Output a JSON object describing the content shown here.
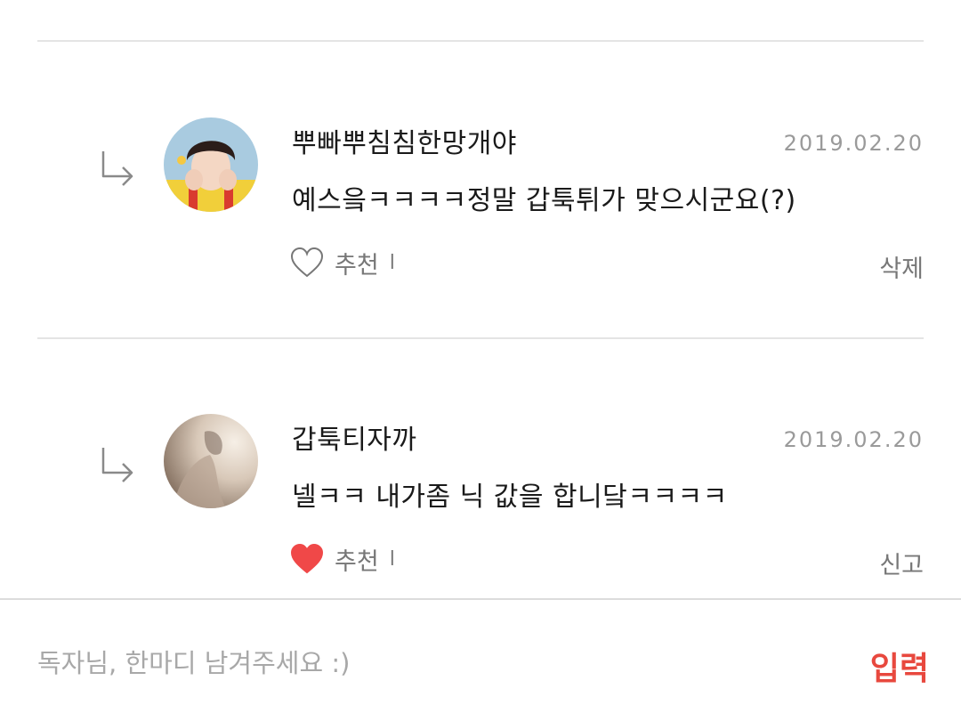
{
  "comments": [
    {
      "author": "뿌빠뿌침침한망개야",
      "date": "2019.02.20",
      "text": "예스읔ㅋㅋㅋㅋ정말 갑툭튀가 맞으시군요(?)",
      "like_label": "추천",
      "like_separator": "l",
      "liked": false,
      "action": "삭제"
    },
    {
      "author": "갑툭티자까",
      "date": "2019.02.20",
      "text": "넬ㅋㅋ 내가좀 닉 값을 합니닼ㅋㅋㅋㅋ",
      "like_label": "추천",
      "like_separator": "l",
      "liked": true,
      "action": "신고"
    }
  ],
  "input": {
    "placeholder": "독자님, 한마디 남겨주세요 :)",
    "value": "",
    "submit_label": "입력"
  },
  "colors": {
    "accent": "#e8483e",
    "like_active": "#f04848",
    "muted_text": "#777777",
    "date_text": "#9a9a9a",
    "divider": "#e4e4e4"
  }
}
